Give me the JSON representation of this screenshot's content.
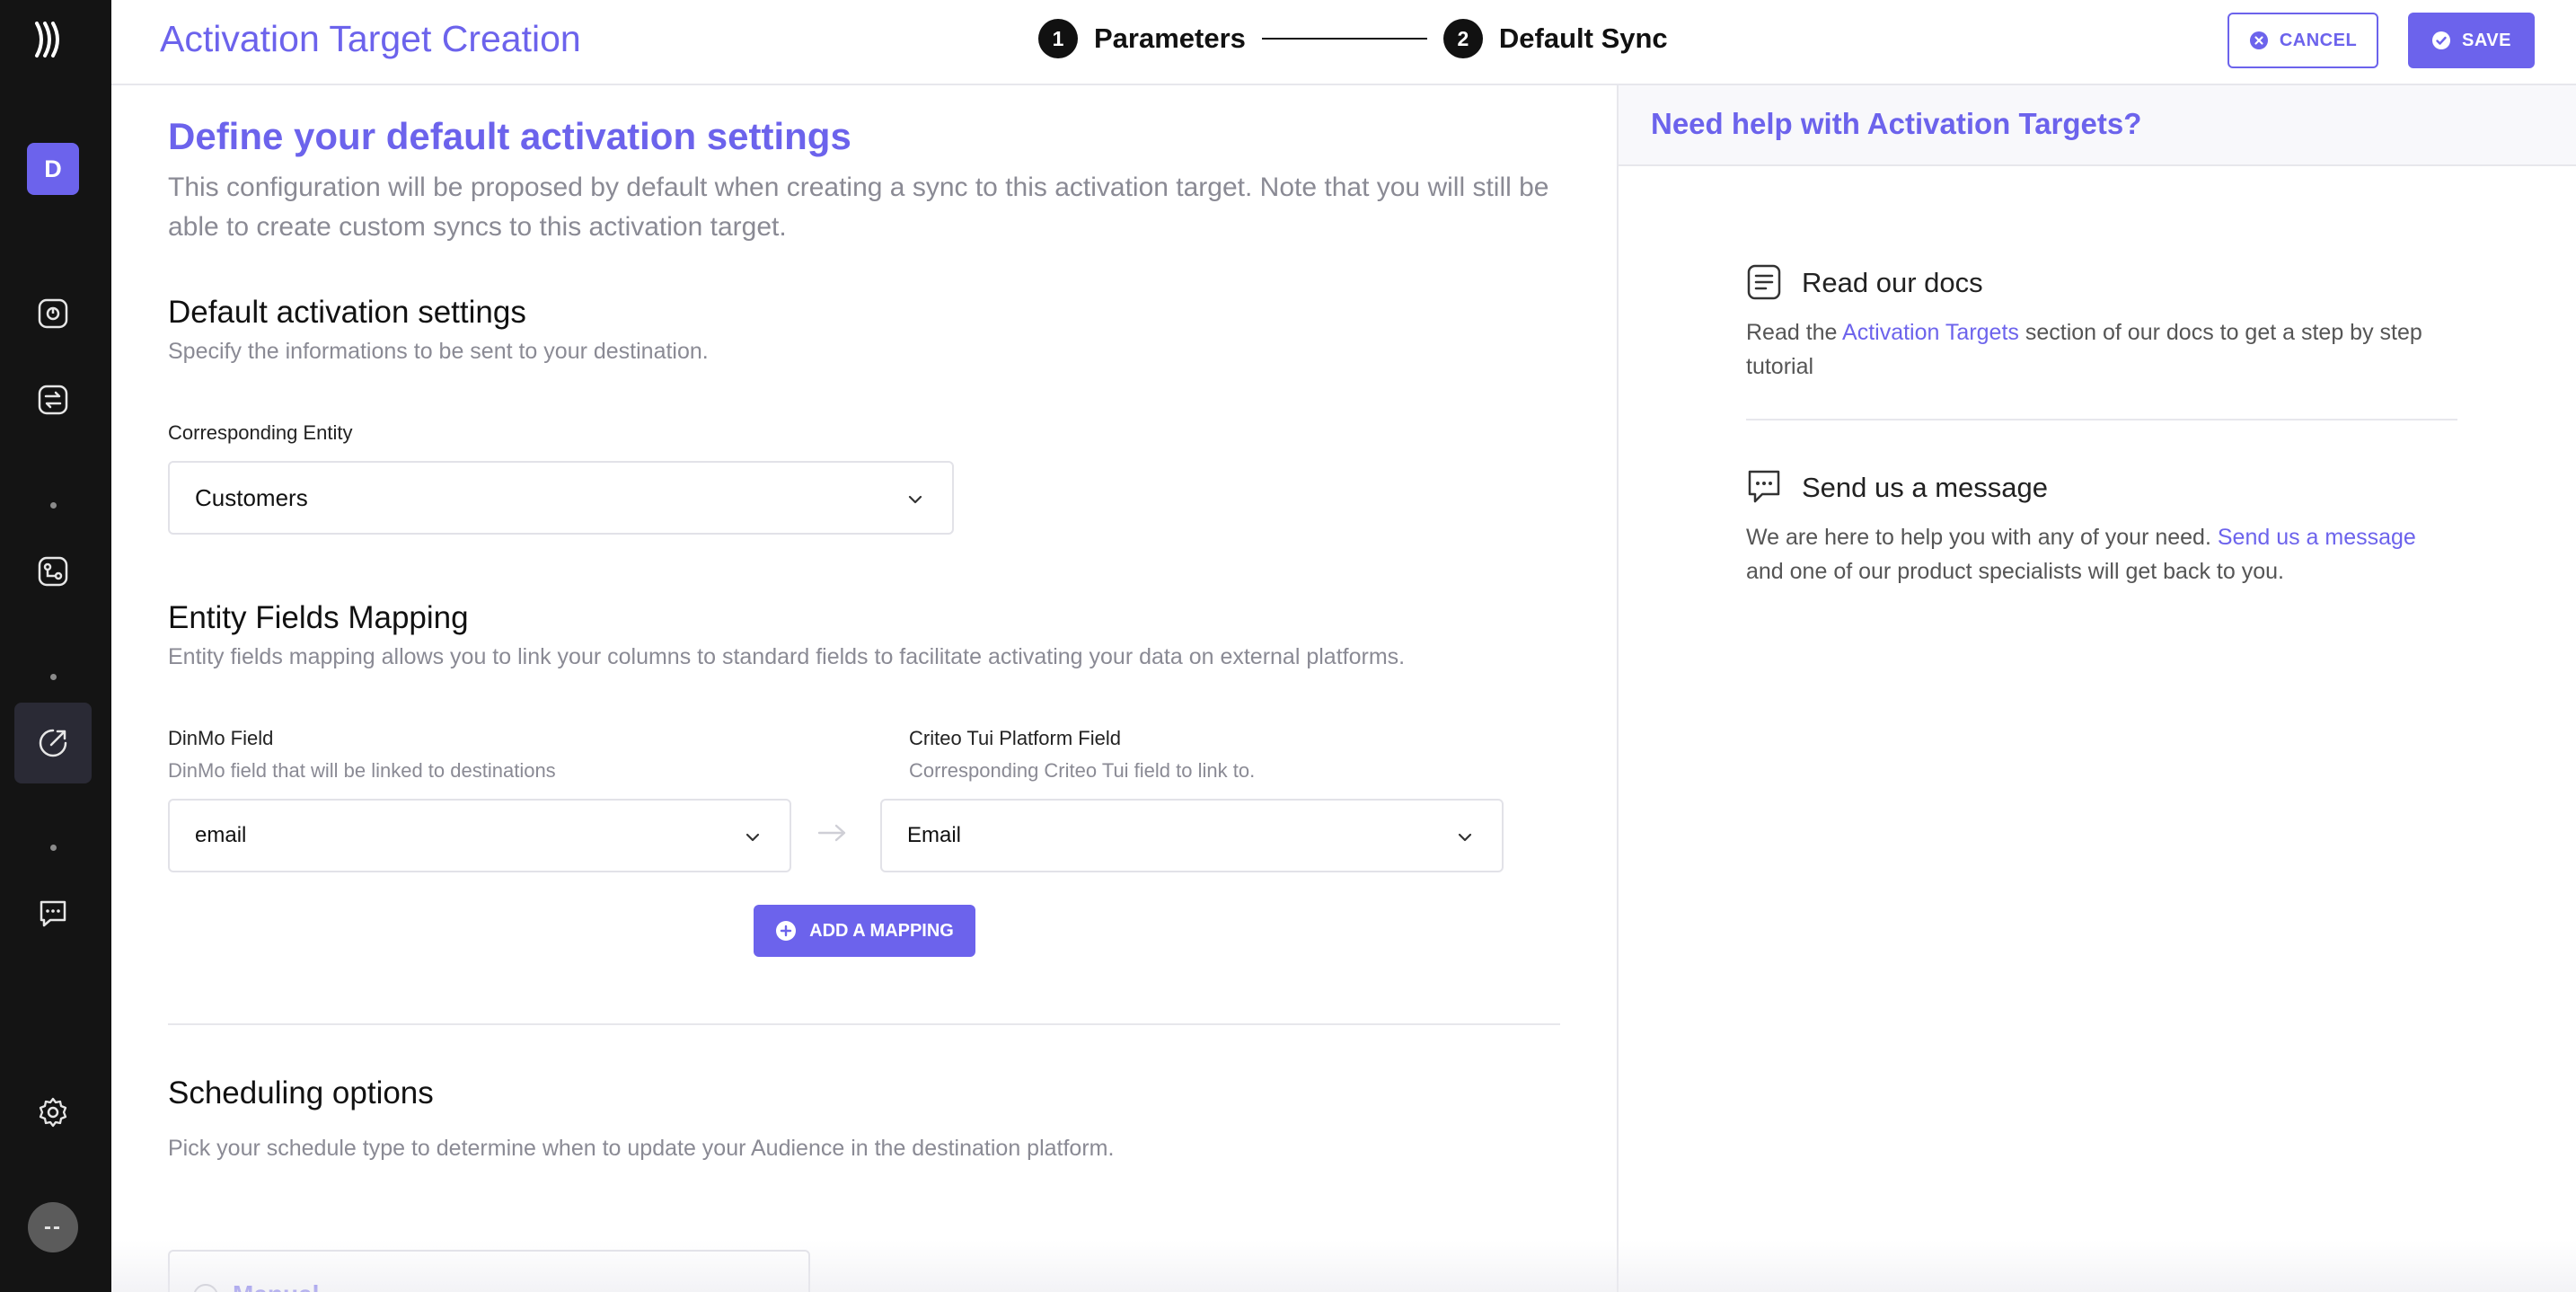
{
  "sidebar": {
    "logo_icon": "dinmo-waves-logo-icon",
    "workspace_initial": "D",
    "items": [
      {
        "name": "analytics-icon"
      },
      {
        "name": "sync-icon"
      },
      {
        "name": "integrations-icon"
      },
      {
        "name": "activation-icon"
      },
      {
        "name": "chat-icon"
      }
    ],
    "settings_icon": "gear-icon",
    "user_initials": "--"
  },
  "header": {
    "title": "Activation Target Creation",
    "steps": [
      {
        "number": "1",
        "label": "Parameters"
      },
      {
        "number": "2",
        "label": "Default Sync"
      }
    ],
    "cancel_label": "CANCEL",
    "save_label": "SAVE"
  },
  "main": {
    "title": "Define your default activation settings",
    "intro": "This configuration will be proposed by default when creating a sync to this activation target. Note that you will still be able to create custom syncs to this activation target.",
    "default_settings": {
      "title": "Default activation settings",
      "subtitle": "Specify the informations to be sent to your destination.",
      "entity_label": "Corresponding Entity",
      "entity_value": "Customers"
    },
    "mapping": {
      "title": "Entity Fields Mapping",
      "subtitle": "Entity fields mapping allows you to link your columns to standard fields to facilitate activating your data on external platforms.",
      "left_label": "DinMo Field",
      "left_help": "DinMo field that will be linked to destinations",
      "left_value": "email",
      "right_label": "Criteo Tui Platform Field",
      "right_help": "Corresponding Criteo Tui field to link to.",
      "right_value": "Email",
      "add_label": "ADD A MAPPING"
    },
    "scheduling": {
      "title": "Scheduling options",
      "subtitle": "Pick your schedule type to determine when to update your Audience in the destination platform.",
      "option_label": "Manual"
    }
  },
  "help": {
    "title": "Need help with Activation Targets?",
    "docs": {
      "title": "Read our docs",
      "text_before": "Read the ",
      "link": "Activation Targets",
      "text_after": " section of our docs to get a step by step tutorial"
    },
    "message": {
      "title": "Send us a message",
      "text_before": "We are here to help you with any of your need. ",
      "link": "Send us a message",
      "text_after": " and one of our product specialists will get back to you."
    }
  },
  "colors": {
    "accent": "#6c63ec",
    "sidebar_bg": "#141414",
    "muted_text": "#8a8a94"
  }
}
